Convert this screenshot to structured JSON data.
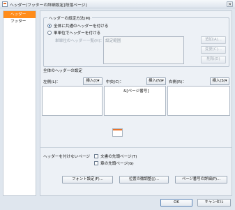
{
  "window": {
    "title": "ヘッダー/フッターの詳細設定(段落ページ)"
  },
  "sidebar": {
    "items": [
      {
        "label": "ヘッダー"
      },
      {
        "label": "フッター"
      }
    ]
  },
  "setting_method": {
    "legend": "ヘッダーの設定方法(M)",
    "option_common": "全体に共通のヘッダーを付ける",
    "option_per_unit": "単単位でヘッダーを付ける",
    "unit_list_label": "単単位のヘッダー一覧(H)：",
    "unit_list_value": "設定範囲",
    "btn_add": "追加(A)...",
    "btn_change": "変更(C)...",
    "btn_delete": "削除(D)"
  },
  "common_header": {
    "title": "全体のヘッダーの設定",
    "left_label": "左側(L)：",
    "center_label": "中央(C)：",
    "right_label": "右側(R)：",
    "insert_left": "挿入(I)▾",
    "insert_center": "挿入(N)▾",
    "insert_right": "挿入(S)▾",
    "center_value": "&[ページ番号]"
  },
  "no_header": {
    "label": "ヘッダーを付けないページ",
    "opt_doc_first": "文書の先頭ページ(T)",
    "opt_chapter_first": "章の先頭ページ(G)"
  },
  "footer_buttons": {
    "font": "フォント設定(F)...",
    "position": "位置の微調整(J)...",
    "page_number": "ページ番号の詳細(P)..."
  },
  "dialog_buttons": {
    "ok": "OK",
    "cancel": "キャンセル"
  }
}
